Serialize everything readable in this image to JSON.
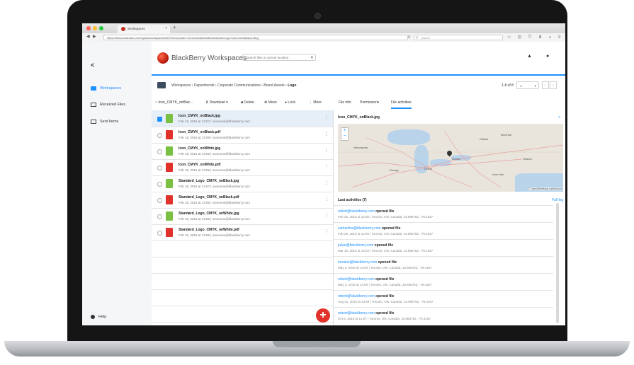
{
  "browser": {
    "tab_title": "Workspaces",
    "tab_close": "×",
    "new_tab": "+",
    "url": "https://citlock.watchdox.com/ngdox/workspaces/316749/Corporate Communications/Brand Assets/Logo?sort=name&ascending",
    "search_placeholder": "Search",
    "search_icon": "search-icon",
    "nav_back": "◀",
    "nav_forward": "▶",
    "reload": "C",
    "toolbar_icons": "☆ ⊡ ⛉ ⬇ ⌂ ≡"
  },
  "sidebar": {
    "collapse": "<",
    "items": [
      {
        "label": "Workspaces",
        "icon": "briefcase-icon",
        "active": true
      },
      {
        "label": "Received Files",
        "icon": "inbox-icon",
        "active": false
      },
      {
        "label": "Sent Items",
        "icon": "sent-icon",
        "active": false
      }
    ],
    "help": "Help"
  },
  "header": {
    "brand": "BlackBerry Workspaces",
    "search_placeholder": "Search files in current location",
    "search_icon": "🔍",
    "bell_icon": "🔔",
    "user_icon": "👤"
  },
  "breadcrumb": {
    "items": [
      "Workspaces",
      "Departments",
      "Corporate Communications",
      "Brand Assets"
    ],
    "current": "Logo",
    "separator": "›",
    "range": "1-8 of 8",
    "page": "1",
    "prev": "‹",
    "next": "›"
  },
  "actions": {
    "selected": "Icon_CMYK_onBlac...",
    "download": "Download",
    "delete": "Delete",
    "move": "Move",
    "lock": "Lock",
    "more": "More"
  },
  "right_tabs": {
    "file_info": "File info",
    "permissions": "Permissions",
    "file_activities": "File activities"
  },
  "files": [
    {
      "name": "Icon_CMYK_onBlack.jpg",
      "meta": "Feb 15, 2016 at 13:57 | someone@blackberry.com",
      "type": "jpg",
      "selected": true
    },
    {
      "name": "Icon_CMYK_onBlack.pdf",
      "meta": "Feb 15, 2016 at 13:59 | someone@blackberry.com",
      "type": "pdf",
      "selected": false
    },
    {
      "name": "Icon_CMYK_onWhite.jpg",
      "meta": "Feb 15, 2016 at 13:59 | someone@blackberry.com",
      "type": "jpg",
      "selected": false
    },
    {
      "name": "Icon_CMYK_onWhite.pdf",
      "meta": "Feb 15, 2016 at 13:59 | someone@blackberry.com",
      "type": "pdf",
      "selected": false
    },
    {
      "name": "Standard_Logo_CMYK_onBlack.jpg",
      "meta": "Feb 15, 2016 at 13:57 | someone@blackberry.com",
      "type": "jpg",
      "selected": false
    },
    {
      "name": "Standard_Logo_CMYK_onBlack.pdf",
      "meta": "Feb 15, 2016 at 13:56 | someone@blackberry.com",
      "type": "pdf",
      "selected": false
    },
    {
      "name": "Standard_Logo_CMYK_onWhite.jpg",
      "meta": "Feb 15, 2016 at 13:56 | someone@blackberry.com",
      "type": "jpg",
      "selected": false
    },
    {
      "name": "Standard_Logo_CMYK_onWhite.pdf",
      "meta": "Feb 15, 2016 at 13:56 | someone@blackberry.com",
      "type": "pdf",
      "selected": false
    }
  ],
  "detail": {
    "title": "Icon_CMYK_onBlack.jpg",
    "expand": "⇥",
    "map_zoom_in": "+",
    "map_zoom_out": "−",
    "map_cities": [
      "Montreal",
      "Ottawa",
      "Toronto",
      "Minneapolis",
      "Chicago",
      "Detroit",
      "New York",
      "Boston"
    ],
    "map_attribution": "© OpenStreetMap contributors",
    "last_activities": "Last activities (7)",
    "full_log": "Full log",
    "activities": [
      {
        "who": "robert@blackberry.com",
        "verb": "opened file",
        "detail": "Feb 25, 2016 at 14:00 | Toronto, ON, Canada, 43.666752, -79.4167"
      },
      {
        "who": "samantha@blackberry.com",
        "verb": "opened file",
        "detail": "Feb 25, 2016 at 14:00 | Toronto, ON, Canada, 43.666752, -79.4167"
      },
      {
        "who": "julian@blackberry.com",
        "verb": "opened file",
        "detail": "Mar 19, 2016 at 14:04 | Toronto, ON, Canada, 43.666752, -79.4167"
      },
      {
        "who": "lorraine@blackberry.com",
        "verb": "opened file",
        "detail": "May 3, 2016 at 14:04 | Toronto, ON, Canada, 43.666752, -79.4167"
      },
      {
        "who": "robert@blackberry.com",
        "verb": "opened file",
        "detail": "May 3, 2016 at 14:00 | Toronto, ON, Canada, 43.666752, -79.4167"
      },
      {
        "who": "robert@blackberry.com",
        "verb": "opened file",
        "detail": "Aug 31, 2016 at 13:59 | Toronto, ON, Canada, 43.666752, -79.4167"
      },
      {
        "who": "robert@blackberry.com",
        "verb": "opened file",
        "detail": "Oct 6, 2016 at 12:07 | Toronto, ON, Canada, 43.666752, -79.4167"
      }
    ]
  },
  "fab": "+",
  "colors": {
    "accent": "#1e90ff",
    "brand_red": "#e0322b",
    "jpg_green": "#7ac143"
  }
}
